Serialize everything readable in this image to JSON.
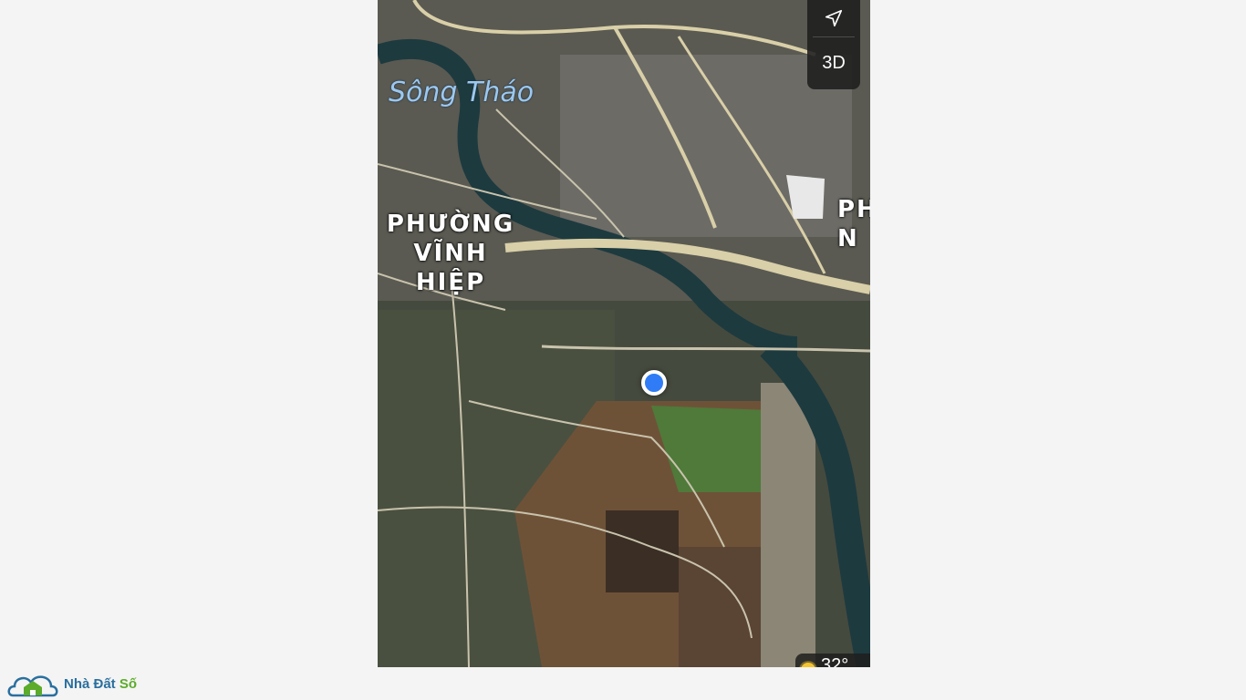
{
  "map": {
    "river_label": "Sông Tháo",
    "ward_left": [
      "PHƯỜNG",
      "VĨNH",
      "HIỆP"
    ],
    "ward_right": [
      "PH",
      "N"
    ],
    "view_mode_button": "3D",
    "location_icon": "navigation-arrow-icon",
    "weather": {
      "icon": "sun-icon",
      "temperature": "32°"
    }
  },
  "logo": {
    "icon": "house-cloud-icon",
    "name_part1": "Nhà Đất ",
    "name_part2": "Số",
    "colors": {
      "primary": "#2a6f9e",
      "accent": "#5cab2a"
    }
  },
  "colors": {
    "location_dot": "#2f7cf6",
    "river": "#1d3a3f",
    "road": "#d9cfa8",
    "field_green": "#4f7a3a",
    "field_brown": "#6e5238"
  }
}
